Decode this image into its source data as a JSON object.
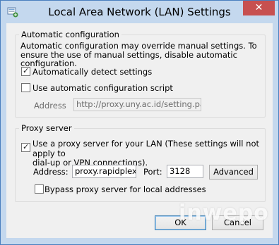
{
  "window": {
    "title": "Local Area Network (LAN) Settings",
    "close_label": "✕"
  },
  "auto_config": {
    "group_title": "Automatic configuration",
    "description": "Automatic configuration may override manual settings.  To ensure the use of manual settings, disable automatic configuration.",
    "detect_label": "Automatically detect settings",
    "detect_checked": true,
    "script_label": "Use automatic configuration script",
    "script_checked": false,
    "address_label": "Address",
    "address_value": "http://proxy.uny.ac.id/setting.pac"
  },
  "proxy": {
    "group_title": "Proxy server",
    "use_proxy_label_line1": "Use a proxy server for your LAN (These settings will not apply to",
    "use_proxy_label_line2": "dial-up or VPN connections).",
    "use_proxy_checked": true,
    "address_label": "Address:",
    "address_value": "proxy.rapidplex.",
    "port_label": "Port:",
    "port_value": "3128",
    "advanced_label": "Advanced",
    "bypass_label": "Bypass proxy server for local addresses",
    "bypass_checked": false
  },
  "buttons": {
    "ok_label": "OK",
    "cancel_label": "Cancel"
  },
  "watermark": "inwepo",
  "colors": {
    "titlebar": "#c4d8ee",
    "close_button": "#c75050",
    "dialog_background": "#f0f0f0"
  }
}
